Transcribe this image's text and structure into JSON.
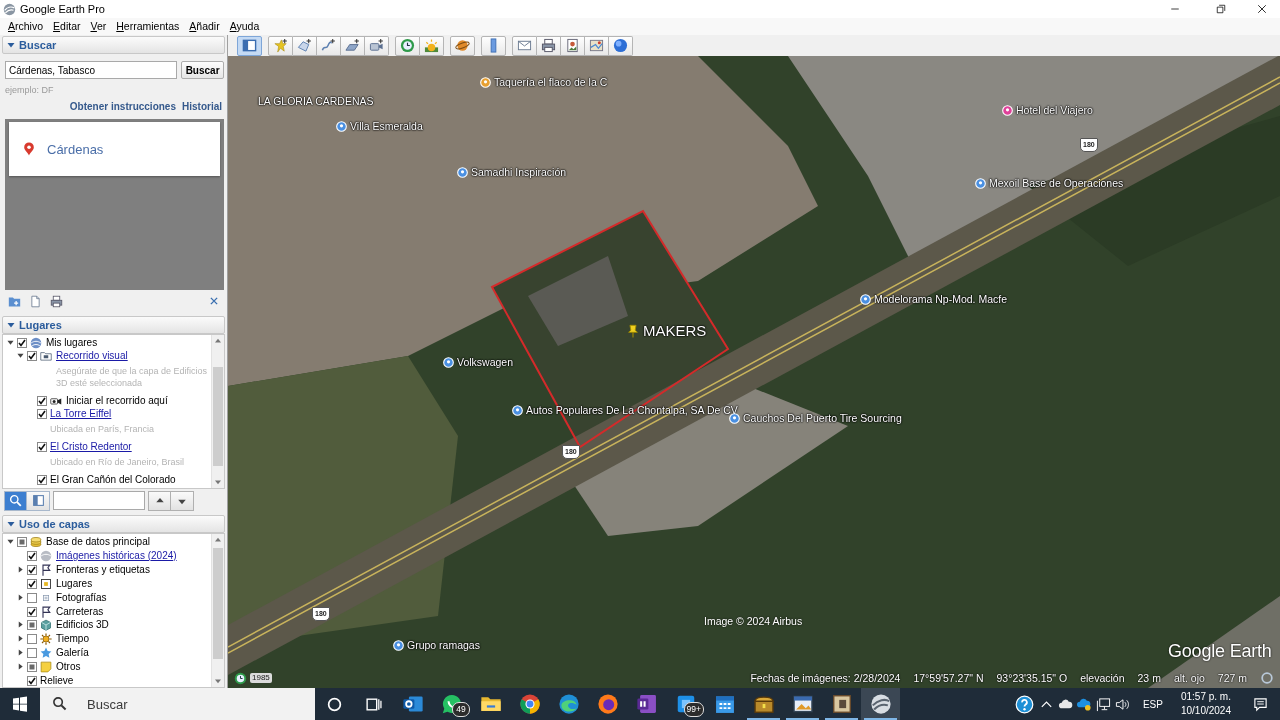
{
  "window": {
    "title": "Google Earth Pro"
  },
  "menu": [
    "Archivo",
    "Editar",
    "Ver",
    "Herramientas",
    "Añadir",
    "Ayuda"
  ],
  "toolbar": {
    "groups": [
      [
        {
          "kind": "sidebar",
          "selected": true
        }
      ],
      [
        {
          "kind": "placemark",
          "selected": false
        },
        {
          "kind": "polygon",
          "selected": false
        },
        {
          "kind": "path",
          "selected": false
        },
        {
          "kind": "overlay",
          "selected": false
        },
        {
          "kind": "tour",
          "selected": false
        }
      ],
      [
        {
          "kind": "history",
          "selected": false
        },
        {
          "kind": "sun",
          "selected": false
        }
      ],
      [
        {
          "kind": "planets",
          "selected": false
        }
      ],
      [
        {
          "kind": "ruler",
          "selected": false
        }
      ],
      [
        {
          "kind": "email",
          "selected": false
        },
        {
          "kind": "print",
          "selected": false
        },
        {
          "kind": "save-image",
          "selected": false
        },
        {
          "kind": "maps",
          "selected": false
        },
        {
          "kind": "earth",
          "selected": false
        }
      ]
    ]
  },
  "search": {
    "title": "Buscar",
    "expanded": true,
    "query": "Cárdenas, Tabasco",
    "button": "Buscar",
    "hint": "ejemplo: DF",
    "links": [
      "Obtener instrucciones",
      "Historial"
    ],
    "results": [
      {
        "name": "Cárdenas"
      }
    ]
  },
  "places": {
    "title": "Lugares",
    "expanded": true,
    "items": [
      {
        "label": "Mis lugares",
        "kind": "globe",
        "link": false,
        "checked": true,
        "expanded": true,
        "children": [
          {
            "label": "Recorrido visual",
            "kind": "tour-folder",
            "link": true,
            "checked": true,
            "expanded": true,
            "description": "Asegúrate de que la capa de Edificios 3D esté seleccionada",
            "children": [
              {
                "label": "Iniciar el recorrido aquí",
                "kind": "tour",
                "link": false,
                "checked": true
              },
              {
                "label": "La Torre Eiffel",
                "kind": "place",
                "link": true,
                "checked": true,
                "description": "Ubicada en París, Francia"
              },
              {
                "label": "El Cristo Redentor",
                "kind": "place",
                "link": true,
                "checked": true,
                "description": "Ubicado en Río de Janeiro, Brasil"
              },
              {
                "label": "El Gran Cañón del Colorado",
                "kind": "place",
                "link": false,
                "checked": true
              }
            ]
          }
        ]
      }
    ],
    "search_modes": [
      {
        "kind": "search",
        "selected": true
      },
      {
        "kind": "panel",
        "selected": false
      }
    ]
  },
  "layers": {
    "title": "Uso de capas",
    "expanded": true,
    "items": [
      {
        "label": "Base de datos principal",
        "kind": "database",
        "link": false,
        "checked": false,
        "partial": true,
        "expanded": true,
        "children": [
          {
            "label": "Imágenes históricas (2024)",
            "kind": "history",
            "link": true,
            "checked": true,
            "partial": false
          },
          {
            "label": "Fronteras y etiquetas",
            "kind": "borders",
            "link": false,
            "checked": true,
            "partial": false,
            "expanded": false
          },
          {
            "label": "Lugares",
            "kind": "places",
            "link": false,
            "checked": true,
            "partial": false
          },
          {
            "label": "Fotografías",
            "kind": "photos",
            "link": false,
            "checked": false,
            "partial": false,
            "expanded": false
          },
          {
            "label": "Carreteras",
            "kind": "roads",
            "link": false,
            "checked": true,
            "partial": false
          },
          {
            "label": "Edificios 3D",
            "kind": "buildings",
            "link": false,
            "checked": false,
            "partial": true,
            "expanded": false
          },
          {
            "label": "Tiempo",
            "kind": "weather",
            "link": false,
            "checked": false,
            "partial": false,
            "expanded": false
          },
          {
            "label": "Galería",
            "kind": "gallery",
            "link": false,
            "checked": false,
            "partial": false,
            "expanded": false
          },
          {
            "label": "Otros",
            "kind": "others",
            "link": false,
            "checked": false,
            "partial": true,
            "expanded": false
          },
          {
            "label": "Relieve",
            "kind": "terrain",
            "link": false,
            "checked": true,
            "partial": false
          }
        ]
      }
    ]
  },
  "map": {
    "labels": [
      {
        "text": "Taquería el flaco de la C",
        "kind": "food"
      },
      {
        "text": "LA GLORIA CARDENAS",
        "kind": "plain"
      },
      {
        "text": "Villa Esmeralda",
        "kind": "poi"
      },
      {
        "text": "Samadhi Inspiración",
        "kind": "poi"
      },
      {
        "text": "Hotel del Viajero",
        "kind": "hotel"
      },
      {
        "text": "Mexoil Base de Operaciones",
        "kind": "poi"
      },
      {
        "text": "Modelorama Np-Mod. Macfe",
        "kind": "poi"
      },
      {
        "text": "MAKERS",
        "kind": "placemark"
      },
      {
        "text": "Volkswagen",
        "kind": "poi"
      },
      {
        "text": "Autos Populares De La Chontalpa, SA De CV",
        "kind": "poi"
      },
      {
        "text": "Cauchos Del Puerto Tire Sourcing",
        "kind": "poi"
      },
      {
        "text": "Grupo ramagas",
        "kind": "poi"
      },
      {
        "text": "180",
        "kind": "shield"
      },
      {
        "text": "180",
        "kind": "shield"
      },
      {
        "text": "180",
        "kind": "shield"
      },
      {
        "text": "Image © 2024 Airbus",
        "kind": "credit"
      },
      {
        "text": "Google Earth",
        "kind": "logo"
      }
    ]
  },
  "status_bar": {
    "history_year": "1985",
    "image_date": "Fechas de imágenes: 2/28/2024",
    "latitude": "17°59'57.27\" N",
    "longitude": "93°23'35.15\" O",
    "elevation_label": "elevación",
    "elevation": "23 m",
    "eye_alt_label": "alt. ojo",
    "eye_alt": "727 m"
  },
  "taskbar": {
    "placeholder": "Buscar",
    "apps": [
      {
        "kind": "search-ring",
        "running": false,
        "selected": false
      },
      {
        "kind": "task-view",
        "running": false,
        "selected": false
      },
      {
        "kind": "mail",
        "running": false,
        "selected": false
      },
      {
        "kind": "chat",
        "running": false,
        "selected": false,
        "badge": "49"
      },
      {
        "kind": "folder",
        "running": false,
        "selected": false
      },
      {
        "kind": "chrome",
        "running": false,
        "selected": false
      },
      {
        "kind": "edge",
        "running": false,
        "selected": false
      },
      {
        "kind": "firefox",
        "running": false,
        "selected": false
      },
      {
        "kind": "notes",
        "running": false,
        "selected": false
      },
      {
        "kind": "store",
        "running": false,
        "selected": false,
        "badge": "99+"
      },
      {
        "kind": "calendar",
        "running": false,
        "selected": false
      },
      {
        "kind": "chest",
        "running": true,
        "selected": false
      },
      {
        "kind": "photo-app",
        "running": true,
        "selected": false
      },
      {
        "kind": "book",
        "running": true,
        "selected": false
      },
      {
        "kind": "earth",
        "running": true,
        "selected": true
      }
    ],
    "language": "ESP",
    "time": "01:57 p. m.",
    "date": "10/10/2024"
  }
}
